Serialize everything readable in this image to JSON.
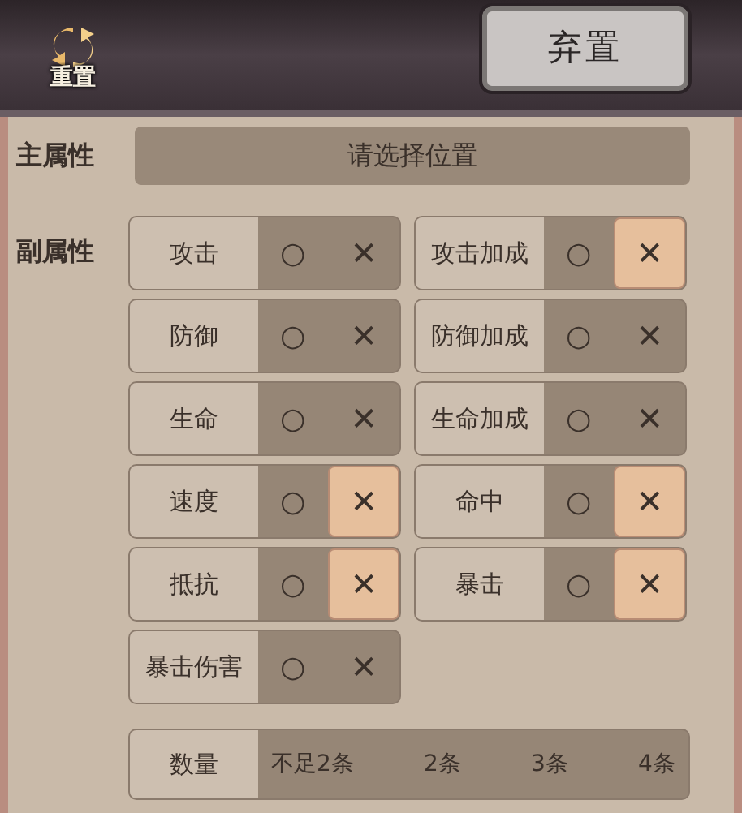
{
  "header": {
    "reset_label": "重置",
    "discard_button": "弃置"
  },
  "main_attribute": {
    "label": "主属性",
    "value": "请选择位置"
  },
  "sub_attributes": {
    "label": "副属性",
    "items": [
      {
        "name": "攻击",
        "circle": "○",
        "cross": "✕",
        "circle_selected": false,
        "cross_selected": false
      },
      {
        "name": "攻击加成",
        "circle": "○",
        "cross": "✕",
        "circle_selected": false,
        "cross_selected": true
      },
      {
        "name": "防御",
        "circle": "○",
        "cross": "✕",
        "circle_selected": false,
        "cross_selected": false
      },
      {
        "name": "防御加成",
        "circle": "○",
        "cross": "✕",
        "circle_selected": false,
        "cross_selected": false
      },
      {
        "name": "生命",
        "circle": "○",
        "cross": "✕",
        "circle_selected": false,
        "cross_selected": false
      },
      {
        "name": "生命加成",
        "circle": "○",
        "cross": "✕",
        "circle_selected": false,
        "cross_selected": false
      },
      {
        "name": "速度",
        "circle": "○",
        "cross": "✕",
        "circle_selected": false,
        "cross_selected": true
      },
      {
        "name": "命中",
        "circle": "○",
        "cross": "✕",
        "circle_selected": false,
        "cross_selected": true
      },
      {
        "name": "抵抗",
        "circle": "○",
        "cross": "✕",
        "circle_selected": false,
        "cross_selected": true
      },
      {
        "name": "暴击",
        "circle": "○",
        "cross": "✕",
        "circle_selected": false,
        "cross_selected": true
      },
      {
        "name": "暴击伤害",
        "circle": "○",
        "cross": "✕",
        "circle_selected": false,
        "cross_selected": false
      }
    ]
  },
  "quantity": {
    "label": "数量",
    "options": [
      {
        "label": "不足2条",
        "selected": false
      },
      {
        "label": "2条",
        "selected": false
      },
      {
        "label": "3条",
        "selected": false
      },
      {
        "label": "4条",
        "selected": false
      }
    ]
  }
}
